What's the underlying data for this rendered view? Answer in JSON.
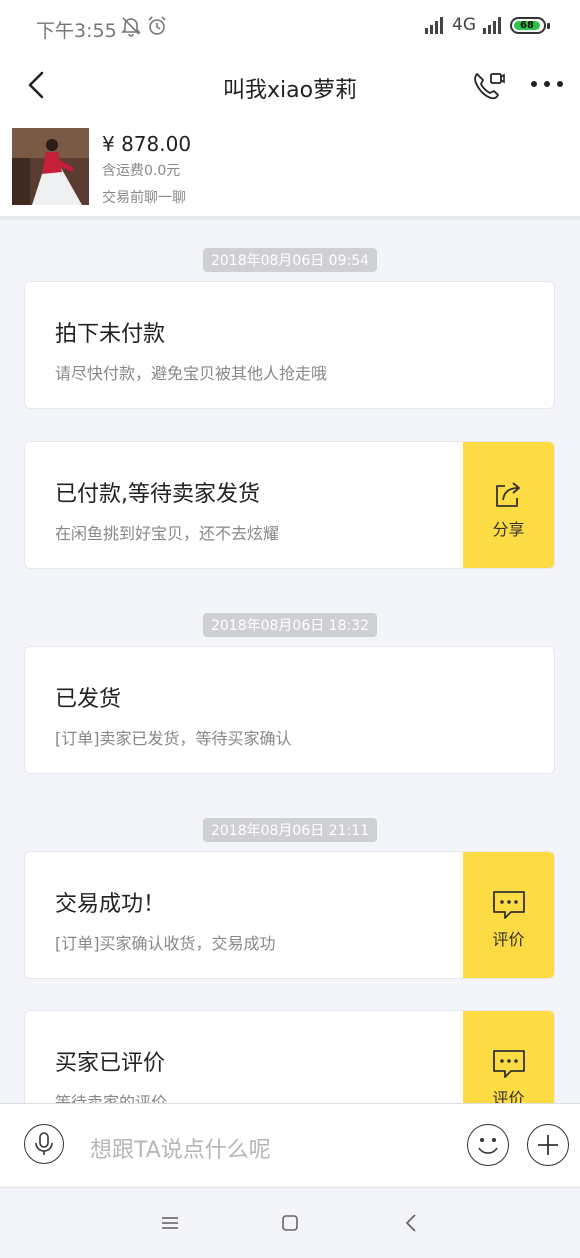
{
  "status_bar": {
    "time": "下午3:55",
    "network": "4G",
    "battery": "68"
  },
  "header": {
    "title": "叫我xiao萝莉"
  },
  "product": {
    "price": "¥ 878.00",
    "shipping": "含运费0.0元",
    "chat_hint": "交易前聊一聊"
  },
  "timeline": {
    "stamp1": "2018年08月06日 09:54",
    "stamp2": "2018年08月06日 18:32",
    "stamp3": "2018年08月06日 21:11",
    "cards": [
      {
        "title": "拍下未付款",
        "subtitle": "请尽快付款，避免宝贝被其他人抢走哦"
      },
      {
        "title": "已付款,等待卖家发货",
        "subtitle": "在闲鱼挑到好宝贝，还不去炫耀",
        "action": "分享"
      },
      {
        "title": "已发货",
        "subtitle": "[订单]卖家已发货，等待买家确认"
      },
      {
        "title": "交易成功！",
        "subtitle": "[订单]买家确认收货，交易成功",
        "action": "评价"
      },
      {
        "title": "买家已评价",
        "subtitle": "等待卖家的评价",
        "action": "评价"
      }
    ]
  },
  "input_bar": {
    "placeholder": "想跟TA说点什么呢"
  },
  "colors": {
    "accent": "#fddb42",
    "background": "#f4f5fa",
    "stamp_bg": "#cfd0d4"
  },
  "icons": [
    "mute-bell-icon",
    "alarm-icon",
    "signal-icon",
    "battery-icon",
    "back-arrow-icon",
    "video-phone-icon",
    "more-dots-icon",
    "share-icon",
    "comment-icon",
    "microphone-icon",
    "emoji-icon",
    "plus-icon",
    "menu-nav-icon",
    "home-nav-icon",
    "back-nav-icon"
  ]
}
